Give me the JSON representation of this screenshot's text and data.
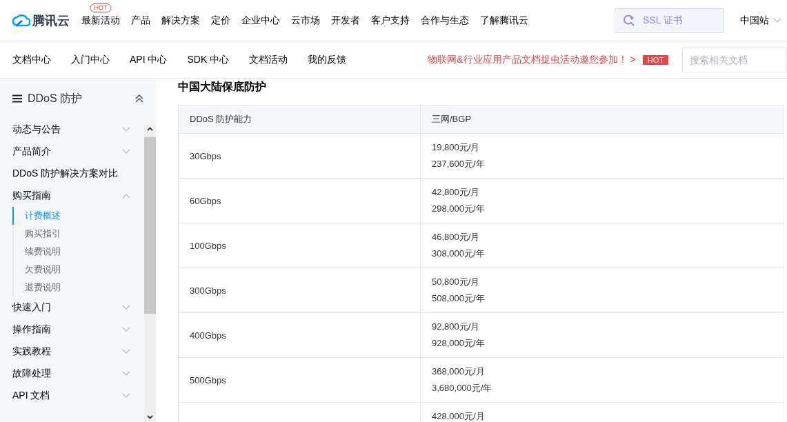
{
  "header": {
    "logo": "腾讯云",
    "nav": [
      {
        "label": "最新活动",
        "badge": "HOT"
      },
      {
        "label": "产品"
      },
      {
        "label": "解决方案"
      },
      {
        "label": "定价"
      },
      {
        "label": "企业中心"
      },
      {
        "label": "云市场"
      },
      {
        "label": "开发者"
      },
      {
        "label": "客户支持"
      },
      {
        "label": "合作与生态"
      },
      {
        "label": "了解腾讯云"
      }
    ],
    "search": {
      "value": "SSL 证书"
    },
    "region": "中国站"
  },
  "subnav": {
    "items": [
      "文档中心",
      "入门中心",
      "API 中心",
      "SDK 中心",
      "文档活动",
      "我的反馈"
    ],
    "promo": "物联网&行业应用产品文档捉虫活动邀您参加！ >",
    "promo_badge": "HOT",
    "search": {
      "placeholder": "搜索相关文档"
    }
  },
  "sidebar": {
    "title": "DDoS 防护",
    "items": [
      {
        "label": "动态与公告",
        "expanded": false,
        "has_children": true
      },
      {
        "label": "产品简介",
        "expanded": false,
        "has_children": true
      },
      {
        "label": "DDoS 防护解决方案对比",
        "has_children": false
      },
      {
        "label": "购买指南",
        "expanded": true,
        "has_children": true,
        "children": [
          {
            "label": "计费概述",
            "selected": true
          },
          {
            "label": "购买指引",
            "selected": false
          },
          {
            "label": "续费说明",
            "selected": false
          },
          {
            "label": "欠费说明",
            "selected": false
          },
          {
            "label": "退费说明",
            "selected": false
          }
        ]
      },
      {
        "label": "快速入门",
        "expanded": false,
        "has_children": true
      },
      {
        "label": "操作指南",
        "expanded": false,
        "has_children": true
      },
      {
        "label": "实践教程",
        "expanded": false,
        "has_children": true
      },
      {
        "label": "故障处理",
        "expanded": false,
        "has_children": true
      },
      {
        "label": "API 文档",
        "expanded": false,
        "has_children": true
      }
    ]
  },
  "content": {
    "heading": "中国大陆保底防护",
    "table": {
      "columns": [
        "DDoS 防护能力",
        "三网/BGP"
      ],
      "rows": [
        {
          "capacity": "30Gbps",
          "prices": [
            "19,800元/月",
            "237,600元/年"
          ]
        },
        {
          "capacity": "60Gbps",
          "prices": [
            "42,800元/月",
            "298,000元/年"
          ]
        },
        {
          "capacity": "100Gbps",
          "prices": [
            "46,800元/月",
            "308,000元/年"
          ]
        },
        {
          "capacity": "300Gbps",
          "prices": [
            "50,800元/月",
            "508,000元/年"
          ]
        },
        {
          "capacity": "400Gbps",
          "prices": [
            "92,800元/月",
            "928,000元/年"
          ]
        },
        {
          "capacity": "500Gbps",
          "prices": [
            "368,000元/月",
            "3,680,000元/年"
          ]
        },
        {
          "prices": [
            "428,000元/月"
          ]
        }
      ]
    }
  }
}
